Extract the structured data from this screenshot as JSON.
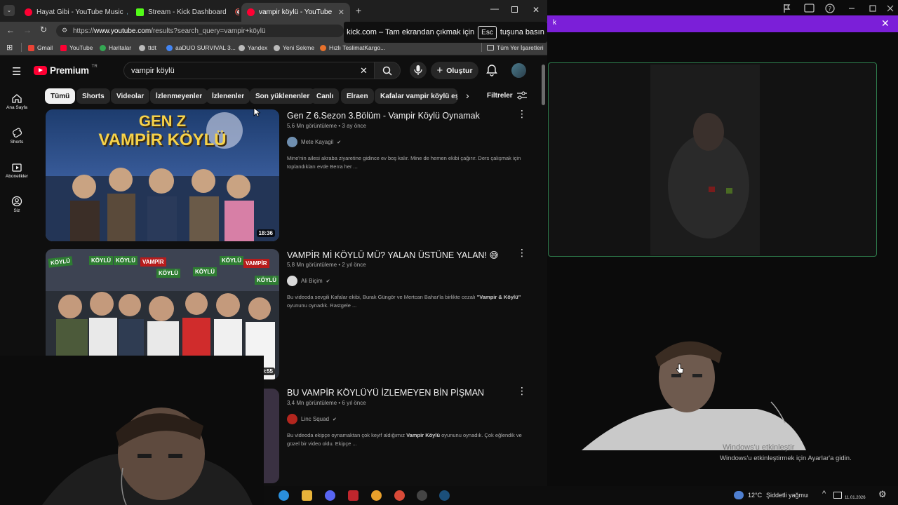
{
  "browser": {
    "tabs": [
      {
        "title": "Hayat Gibi - YouTube Music",
        "favicon": "youtube-music-icon",
        "color": "#ff0033"
      },
      {
        "title": "Stream - Kick Dashboard",
        "favicon": "kick-icon",
        "color": "#53fc18"
      },
      {
        "title": "vampir köylü - YouTube",
        "favicon": "youtube-icon",
        "color": "#ff0033"
      }
    ],
    "url_prefix": "https://",
    "url_host": "www.youtube.com",
    "url_path": "/results?search_query=vampir+köylü",
    "bookmarks": [
      {
        "label": "Gmail",
        "icon": "gmail-icon",
        "color": "#ea4335"
      },
      {
        "label": "YouTube",
        "icon": "youtube-icon",
        "color": "#ff0033"
      },
      {
        "label": "Haritalar",
        "icon": "maps-icon",
        "color": "#34a853"
      },
      {
        "label": "ttdt",
        "icon": "globe-icon",
        "color": "#bbbbbb"
      },
      {
        "label": "aaDUO SURVIVAL 3...",
        "icon": "globe-icon",
        "color": "#4285f4"
      },
      {
        "label": "Yandex",
        "icon": "globe-icon",
        "color": "#bbbbbb"
      },
      {
        "label": "Yeni Sekme",
        "icon": "globe-icon",
        "color": "#bbbbbb"
      },
      {
        "label": "Hızlı TeslimatKargo...",
        "icon": "cargo-icon",
        "color": "#e8712b"
      }
    ],
    "all_bookmarks": "Tüm Yer İşaretleri"
  },
  "toast": {
    "text_before": "kick.com – Tam ekrandan çıkmak için",
    "key": "Esc",
    "text_after": "tuşuna basın"
  },
  "youtube": {
    "logo": "Premium",
    "logo_badge": "TR",
    "search_query": "vampir köylü",
    "create_label": "Oluştur",
    "nav": [
      {
        "label": "Ana Sayfa",
        "icon": "home-icon"
      },
      {
        "label": "Shorts",
        "icon": "shorts-icon"
      },
      {
        "label": "Abonelikler",
        "icon": "subscriptions-icon"
      },
      {
        "label": "Siz",
        "icon": "user-icon"
      }
    ],
    "chips": [
      "Tümü",
      "Shorts",
      "Videolar",
      "İzlenmeyenler",
      "İzlenenler",
      "Son yüklenenler",
      "Canlı",
      "Elraen",
      "Kafalar vampir köylü eşle"
    ],
    "filters_label": "Filtreler",
    "videos": [
      {
        "title": "Gen Z 6.Sezon 3.Bölüm - Vampir Köylü Oynamak",
        "views": "5,6 Mn görüntüleme",
        "age": "3 ay önce",
        "channel": "Mete Kayagil",
        "description": "Mine'nin ailesi akraba ziyaretine gidince ev boş kalır. Mine de hemen ekibi çağırır. Ders çalışmak için toplandıkları evde Berra her ...",
        "duration": "18:36",
        "thumb_text_1": "GEN Z",
        "thumb_text_2": "VAMPİR KÖYLÜ"
      },
      {
        "title": "VAMPİR Mİ KÖYLÜ MÜ? YALAN ÜSTÜNE YALAN! 😅",
        "views": "5,8 Mn görüntüleme",
        "age": "2 yıl önce",
        "channel": "Ali Biçim",
        "description_before": "Bu videoda sevgili Kafalar ekibi, Burak Güngör ve Mertcan Bahar'la birlikte cezalı ",
        "description_bold": "\"Vampir & Köylü\"",
        "description_after": " oyununu oynadık. Rastgele ...",
        "duration": "0:55",
        "thumb_signs": [
          "KÖYLÜ",
          "KÖYLÜ",
          "KÖYLÜ",
          "VAMPİR",
          "KÖYLÜ",
          "KÖYLÜ",
          "KÖYLÜ",
          "VAMPİR",
          "KÖYLÜ"
        ]
      },
      {
        "title": "BU VAMPİR KÖYLÜYÜ İZLEMEYEN BİN PİŞMAN",
        "views": "3,4 Mn görüntüleme",
        "age": "6 yıl önce",
        "channel": "Linc Squad",
        "description_before": "Bu videoda ekipçe oynamaktan çok keyif aldığımız ",
        "description_bold": "Vampir Köylü",
        "description_after": " oyununu oynadık. Çok eğlendik ve güzel bir video oldu. Ekipçe ..."
      }
    ]
  },
  "kick_partial_label": "k",
  "windows_activation": {
    "title": "Windows'u etkinleştir",
    "subtitle": "Windows'u etkinleştirmek için Ayarlar'a gidin."
  },
  "taskbar": {
    "temperature": "12°C",
    "weather": "Şiddetli yağmur",
    "date": "11.01.2026",
    "apps": [
      {
        "icon": "edge-icon",
        "color": "#2a8fdc"
      },
      {
        "icon": "explorer-icon",
        "color": "#e9b43a"
      },
      {
        "icon": "discord-icon",
        "color": "#5865f2"
      },
      {
        "icon": "winrar-icon",
        "color": "#c0262d"
      },
      {
        "icon": "chrome-icon",
        "color": "#e9a02b"
      },
      {
        "icon": "chrome-beta-icon",
        "color": "#d94a38"
      },
      {
        "icon": "obs-icon",
        "color": "#444444"
      },
      {
        "icon": "steam-icon",
        "color": "#1b4f7a"
      }
    ]
  }
}
